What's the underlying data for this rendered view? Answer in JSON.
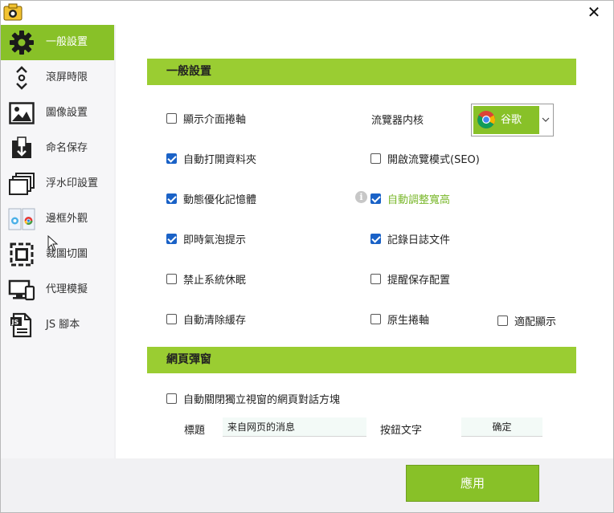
{
  "window": {
    "close_label": "✕"
  },
  "sidebar": {
    "items": [
      {
        "label": "一般設置",
        "icon": "gear-icon",
        "active": true
      },
      {
        "label": "滾屏時限",
        "icon": "scroll-arrows-icon",
        "active": false
      },
      {
        "label": "圖像設置",
        "icon": "image-icon",
        "active": false
      },
      {
        "label": "命名保存",
        "icon": "save-icon",
        "active": false
      },
      {
        "label": "浮水印設置",
        "icon": "watermark-icon",
        "active": false
      },
      {
        "label": "邊框外觀",
        "icon": "browser-frame-icon",
        "active": false
      },
      {
        "label": "裁圖切圖",
        "icon": "crop-icon",
        "active": false
      },
      {
        "label": "代理模擬",
        "icon": "devices-icon",
        "active": false
      },
      {
        "label": "JS 腳本",
        "icon": "js-script-icon",
        "active": false
      }
    ]
  },
  "general": {
    "title": "一般設置",
    "options": [
      {
        "label": "顯示介面捲軸",
        "checked": false
      },
      {
        "label": "自動打開資料夾",
        "checked": true
      },
      {
        "label": "開啟流覽模式(SEO)",
        "checked": false
      },
      {
        "label": "動態優化記憶體",
        "checked": true
      },
      {
        "label": "自動調整寬高",
        "checked": true
      },
      {
        "label": "即時氣泡提示",
        "checked": true
      },
      {
        "label": "記錄日誌文件",
        "checked": true
      },
      {
        "label": "禁止系統休眠",
        "checked": false
      },
      {
        "label": "提醒保存配置",
        "checked": false
      },
      {
        "label": "自動清除緩存",
        "checked": false
      },
      {
        "label": "原生捲軸",
        "checked": false
      },
      {
        "label": "適配顯示",
        "checked": false
      }
    ],
    "engine_label": "流覽器内核",
    "engine_value": "谷歌",
    "info_glyph": "i"
  },
  "popup": {
    "title": "網頁彈窗",
    "auto_close_label": "自動關閉獨立視窗的網頁對話方塊",
    "auto_close_checked": false,
    "title_label": "標題",
    "title_value": "来自网页的消息",
    "button_text_label": "按鈕文字",
    "button_text_value": "确定"
  },
  "footer": {
    "apply_label": "應用"
  },
  "colors": {
    "accent": "#88c128",
    "section": "#9acd32",
    "check": "#1a62c7"
  }
}
